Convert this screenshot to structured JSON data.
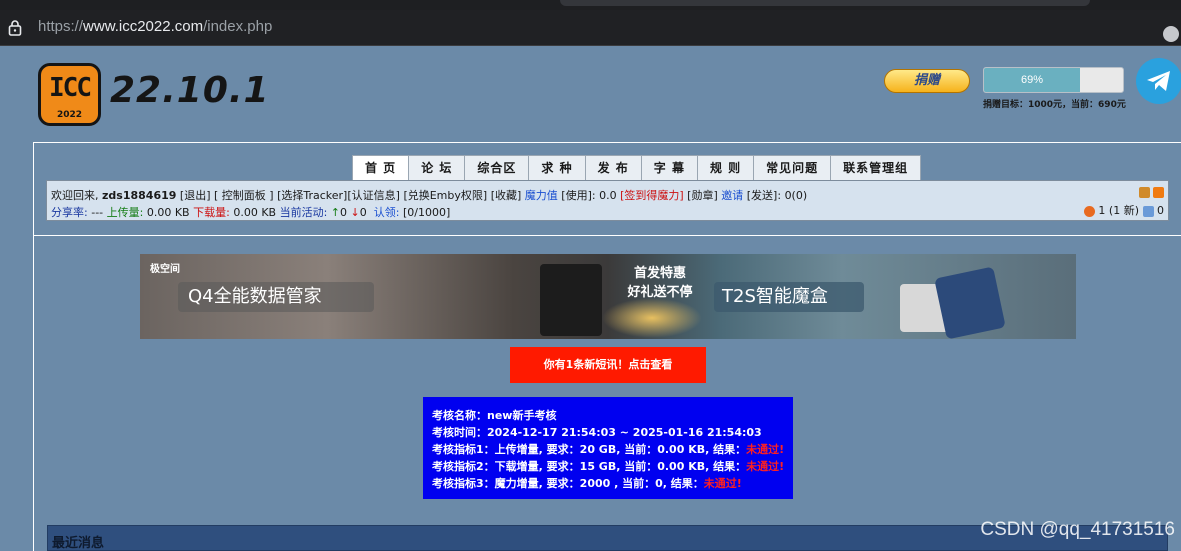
{
  "browser": {
    "url_scheme": "https://",
    "url_host": "www.icc2022.com",
    "url_path": "/index.php"
  },
  "header": {
    "logo_text": "ICC",
    "logo_year": "2022",
    "version": "22.10.1",
    "donate_label": "捐赠",
    "donate_progress": 0.69,
    "donate_percent": "69%",
    "donate_goal": "捐赠目标：1000元，当前：690元",
    "telegram_icon": "telegram-icon"
  },
  "nav": {
    "items": [
      "首 页",
      "论 坛",
      "综合区",
      "求 种",
      "发 布",
      "字 幕",
      "规 则",
      "常见问题",
      "联系管理组"
    ]
  },
  "userbar": {
    "welcome": "欢迎回来,",
    "username": "zds1884619",
    "logout": "[退出]",
    "control_panel": "[ 控制面板 ]",
    "tracker": "[选择Tracker]",
    "cert": "[认证信息]",
    "emby": "[兑换Emby权限]",
    "favorites": "[收藏]",
    "magic_label": "魔力值",
    "use_label": "[使用]:",
    "magic_value": "0.0",
    "signin": "[签到得魔力]",
    "medal": "[勋章]",
    "invite": "邀请",
    "sent": "[发送]:",
    "sent_value": "0(0)",
    "share_label": "分享率:",
    "share_value": "---",
    "upload_label": "上传量:",
    "upload_value": "0.00 KB",
    "download_label": "下载量:",
    "download_value": "0.00 KB",
    "active_label": "当前活动:",
    "active_up": "0",
    "active_down": "0",
    "claim_label": "认领:",
    "claim_value": "[0/1000]",
    "messages": "1 (1 新)",
    "comments": "0"
  },
  "banner": {
    "brand": "极空间",
    "left_tag": "Q4全能数据管家",
    "mid_line1": "首发特惠",
    "mid_line2": "好礼送不停",
    "right_tag": "T2S智能魔盒"
  },
  "notice": {
    "message_button": "你有1条新短讯！点击查看"
  },
  "assessment": {
    "rows": [
      {
        "text": "考核名称：new新手考核",
        "result": ""
      },
      {
        "text": "考核时间：2024-12-17 21:54:03 ~ 2025-01-16 21:54:03",
        "result": ""
      },
      {
        "text": "考核指标1：上传增量, 要求：20 GB, 当前：0.00 KB, 结果：",
        "result": "未通过!"
      },
      {
        "text": "考核指标2：下载增量, 要求：15 GB, 当前：0.00 KB, 结果：",
        "result": "未通过!"
      },
      {
        "text": "考核指标3：魔力增量, 要求：2000 , 当前：0, 结果：",
        "result": "未通过!"
      }
    ]
  },
  "recent": {
    "title": "最近消息"
  },
  "watermark": "CSDN @qq_41731516"
}
